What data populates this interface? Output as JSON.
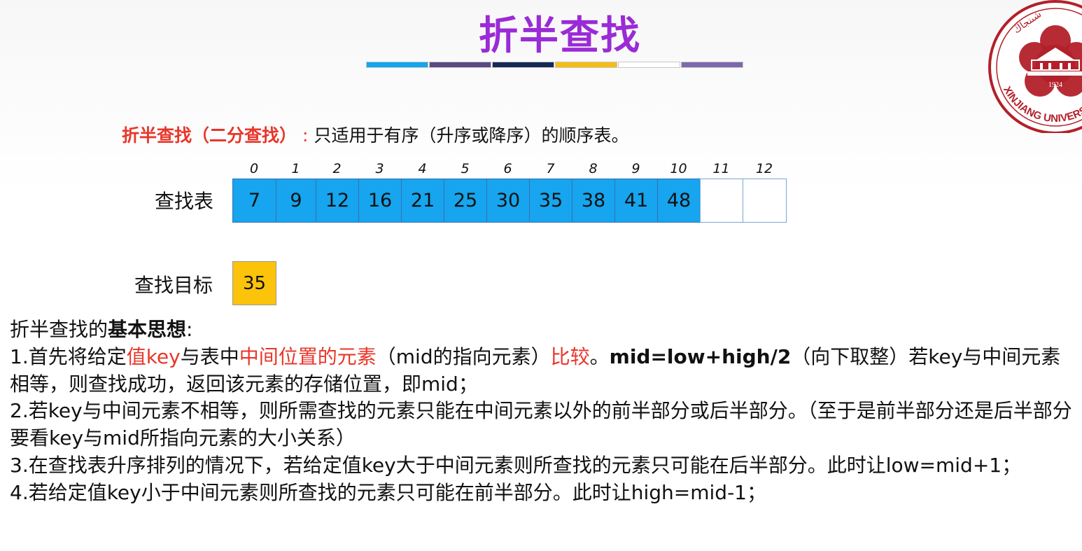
{
  "title": "折半查找",
  "color_bar": [
    "#13a6ec",
    "#5a4a82",
    "#152a55",
    "#f5bc14",
    "#ffffff",
    "#7d68ac"
  ],
  "definition": {
    "term": "折半查找（二分查找）",
    "colon": ":",
    "text": "只适用于有序（升序或降序）的顺序表。"
  },
  "table": {
    "label": "查找表",
    "indices": [
      "0",
      "1",
      "2",
      "3",
      "4",
      "5",
      "6",
      "7",
      "8",
      "9",
      "10",
      "11",
      "12"
    ],
    "values": [
      "7",
      "9",
      "12",
      "16",
      "21",
      "25",
      "30",
      "35",
      "38",
      "41",
      "48",
      "",
      ""
    ]
  },
  "target": {
    "label": "查找目标",
    "value": "35"
  },
  "idea": {
    "heading_prefix": "折半查找的",
    "heading_bold": "基本思想",
    "heading_suffix": ":",
    "item1": {
      "a": "1.首先将给定",
      "b": "值key",
      "c": "与表中",
      "d": "中间位置的元素",
      "e": "（mid的指向元素）",
      "f": "比较",
      "g": "。",
      "h": "mid=low+high/2",
      "i": "（向下取整）若key与中间元素相等，则查找成功，返回该元素的存储位置，即mid；"
    },
    "item2": "2.若key与中间元素不相等，则所需查找的元素只能在中间元素以外的前半部分或后半部分。（至于是前半部分还是后半部分要看key与mid所指向元素的大小关系）",
    "item3": "3.在查找表升序排列的情况下，若给定值key大于中间元素则所查找的元素只可能在后半部分。此时让low=mid+1；",
    "item4": "4.若给定值key小于中间元素则所查找的元素只可能在前半部分。此时让high=mid-1；"
  },
  "logo": {
    "icon": "xinjiang-university-seal-icon",
    "color": "#b3202a",
    "year": "1924",
    "text": "XINJIANG UNIVERSITY"
  }
}
